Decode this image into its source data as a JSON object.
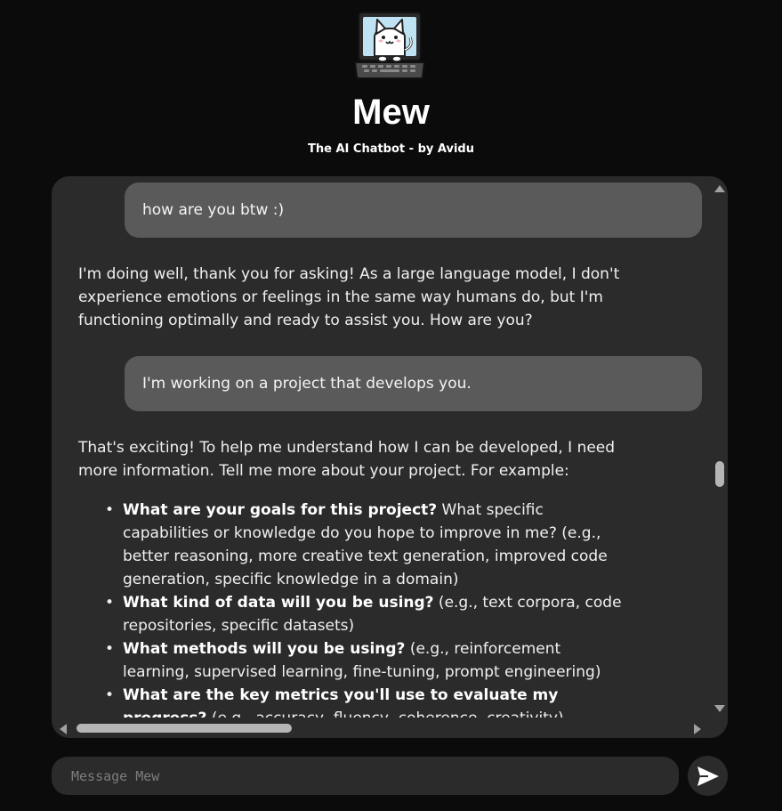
{
  "header": {
    "title": "Mew",
    "subtitle": "The AI Chatbot - by Avidu"
  },
  "messages": [
    {
      "role": "user",
      "text": "how are you btw :)"
    },
    {
      "role": "bot",
      "text": "I'm doing well, thank you for asking! As a large language model, I don't experience emotions or feelings in the same way humans do, but I'm functioning optimally and ready to assist you. How are you?"
    },
    {
      "role": "user",
      "text": "I'm working on a project that develops you."
    },
    {
      "role": "bot",
      "text": "That's exciting! To help me understand how I can be developed, I need more information. Tell me more about your project. For example:"
    }
  ],
  "bot_list": [
    {
      "bold": "What are your goals for this project?",
      "rest": " What specific capabilities or knowledge do you hope to improve in me? (e.g., better reasoning, more creative text generation, improved code generation, specific knowledge in a domain)"
    },
    {
      "bold": "What kind of data will you be using?",
      "rest": " (e.g., text corpora, code repositories, specific datasets)"
    },
    {
      "bold": "What methods will you be using?",
      "rest": " (e.g., reinforcement learning, supervised learning, fine-tuning, prompt engineering)"
    },
    {
      "bold": "What are the key metrics you'll use to evaluate my progress?",
      "rest": " (e.g., accuracy, fluency, coherence, creativity)"
    }
  ],
  "input": {
    "placeholder": "Message Mew",
    "value": ""
  },
  "icons": {
    "logo": "cat-laptop-icon",
    "send": "send-icon"
  },
  "colors": {
    "background": "#0b0b0b",
    "panel": "#2b2b2b",
    "user_bubble": "#5a5a5a",
    "text": "#f0f0f0"
  }
}
